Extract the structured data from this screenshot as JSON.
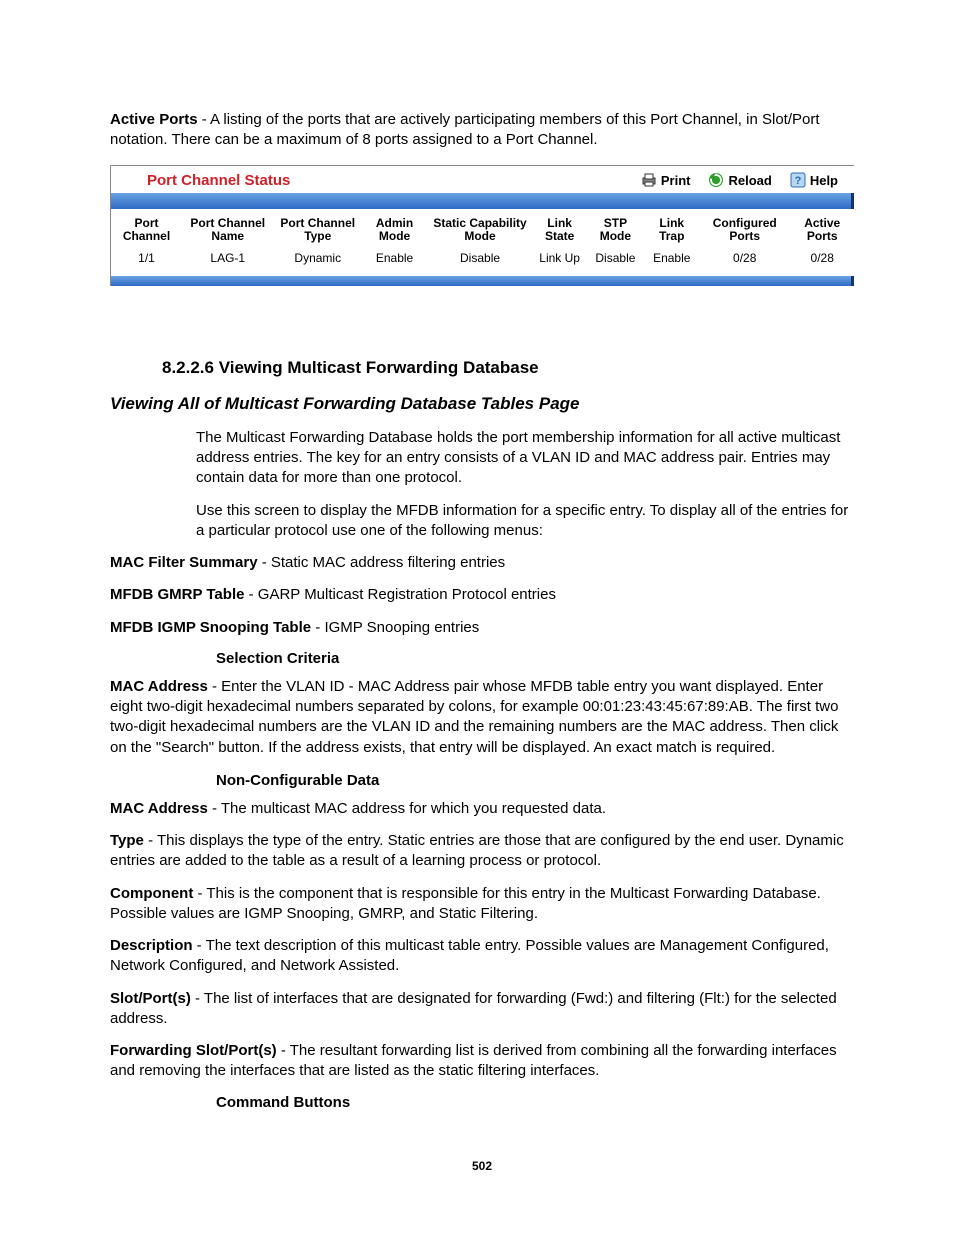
{
  "intro": {
    "active_ports_label": "Active Ports",
    "active_ports_text": " - A listing of the ports that are actively participating members of this Port Channel, in Slot/Port notation. There can be a maximum of 8 ports assigned to a Port Channel."
  },
  "panel": {
    "title": "Port Channel Status",
    "print": "Print",
    "reload": "Reload",
    "help": "Help",
    "headers": {
      "c0": "Port Channel",
      "c1": "Port Channel Name",
      "c2": "Port Channel Type",
      "c3": "Admin Mode",
      "c4": "Static Capability Mode",
      "c5": "Link State",
      "c6": "STP Mode",
      "c7": "Link Trap",
      "c8": "Configured Ports",
      "c9": "Active Ports"
    },
    "row": {
      "c0": "1/1",
      "c1": "LAG-1",
      "c2": "Dynamic",
      "c3": "Enable",
      "c4": "Disable",
      "c5": "Link Up",
      "c6": "Disable",
      "c7": "Enable",
      "c8": "0/28",
      "c9": "0/28"
    }
  },
  "section": {
    "num_title": "8.2.2.6 Viewing Multicast Forwarding Database",
    "italic_title": "Viewing All of Multicast Forwarding Database Tables Page",
    "p1": "The Multicast Forwarding Database holds the port membership information for all active multicast address entries. The key for an entry consists of a VLAN ID and MAC address pair. Entries may contain data for more than one protocol.",
    "p2": "Use this screen to display the MFDB information for a specific entry. To display all of the entries for a particular protocol use one of the following menus:",
    "filters": {
      "f1_label": "MAC Filter Summary",
      "f1_text": " - Static MAC address filtering entries",
      "f2_label": "MFDB GMRP Table",
      "f2_text": " - GARP Multicast Registration Protocol entries",
      "f3_label": "MFDB IGMP Snooping Table",
      "f3_text": " - IGMP Snooping entries"
    },
    "selection_criteria": "Selection Criteria",
    "mac_addr": {
      "label": "MAC Address",
      "text": " - Enter the VLAN ID - MAC Address pair whose MFDB table entry you want displayed. Enter eight two-digit hexadecimal numbers separated by colons, for example 00:01:23:43:45:67:89:AB. The first two two-digit hexadecimal numbers are the VLAN ID and the remaining numbers are the MAC address. Then click on the \"Search\" button. If the address exists, that entry will be displayed. An exact match is required."
    },
    "non_configurable": "Non-Configurable Data",
    "fields": {
      "mac_label": "MAC Address",
      "mac_text": " - The multicast MAC address for which you requested data.",
      "type_label": "Type",
      "type_text": " - This displays the type of the entry. Static entries are those that are configured by the end user. Dynamic entries are added to the table as a result of a learning process or protocol.",
      "comp_label": "Component",
      "comp_text": " - This is the component that is responsible for this entry in the Multicast Forwarding Database. Possible values are IGMP Snooping, GMRP, and Static Filtering.",
      "desc_label": "Description",
      "desc_text": " - The text description of this multicast table entry. Possible values are Management Configured, Network Configured, and Network Assisted.",
      "slot_label": "Slot/Port(s)",
      "slot_text": " - The list of interfaces that are designated for forwarding (Fwd:) and filtering (Flt:) for the selected address.",
      "fwd_label": "Forwarding Slot/Port(s)",
      "fwd_text": " - The resultant forwarding list is derived from combining all the forwarding interfaces and removing the interfaces that are listed as the static filtering interfaces."
    },
    "command_buttons": "Command Buttons"
  },
  "page_number": "502"
}
